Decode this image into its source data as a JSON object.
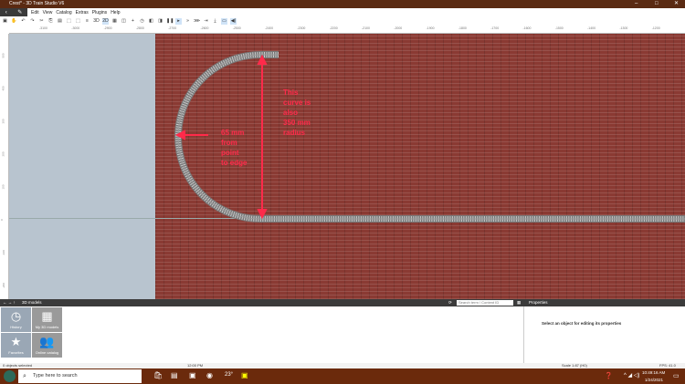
{
  "window": {
    "title": "Crest* - 3D Train Studio V6"
  },
  "menu": [
    "Edit",
    "View",
    "Catalog",
    "Extras",
    "Plugins",
    "Help"
  ],
  "toolbar": {
    "view_3d": "3D",
    "view_2d": "2D"
  },
  "ruler_x": [
    "-3100",
    "-3000",
    "-2900",
    "-2800",
    "-2700",
    "-2600",
    "-2500",
    "-2400",
    "-2300",
    "-2200",
    "-2100",
    "-2000",
    "-1900",
    "-1800",
    "-1700",
    "-1600",
    "-1500",
    "-1400",
    "-1300",
    "-1200"
  ],
  "ruler_y": [
    "500",
    "400",
    "300",
    "200",
    "100",
    "0",
    "-100",
    "-200"
  ],
  "annotations": {
    "left": "65 mm\nfrom\npoint\nto edge",
    "right": "This\ncurve is\nalso\n350 mm\nradius"
  },
  "colors": {
    "annotation": "#ff2a4a",
    "brick": "#8a3a33"
  },
  "library": {
    "title": "3D models",
    "search_placeholder": "Search term / Content ID",
    "tiles": [
      {
        "label": "History",
        "icon": "clock-icon"
      },
      {
        "label": "My 3D models",
        "icon": "grid-icon"
      },
      {
        "label": "Favorites",
        "icon": "star-icon"
      },
      {
        "label": "Online catalog",
        "icon": "people-icon"
      }
    ]
  },
  "properties": {
    "title": "Properties",
    "empty_message": "Select an object for editing its properties"
  },
  "status": {
    "selection": "0 objects selected",
    "time": "12:00 PM",
    "scale": "Scale 1:87 (H0)",
    "fps": "FPS: 41.0"
  },
  "taskbar": {
    "search_placeholder": "Type here to search",
    "weather": "23°",
    "clock_time": "10:49:16 AM",
    "clock_date": "1/24/2021"
  }
}
